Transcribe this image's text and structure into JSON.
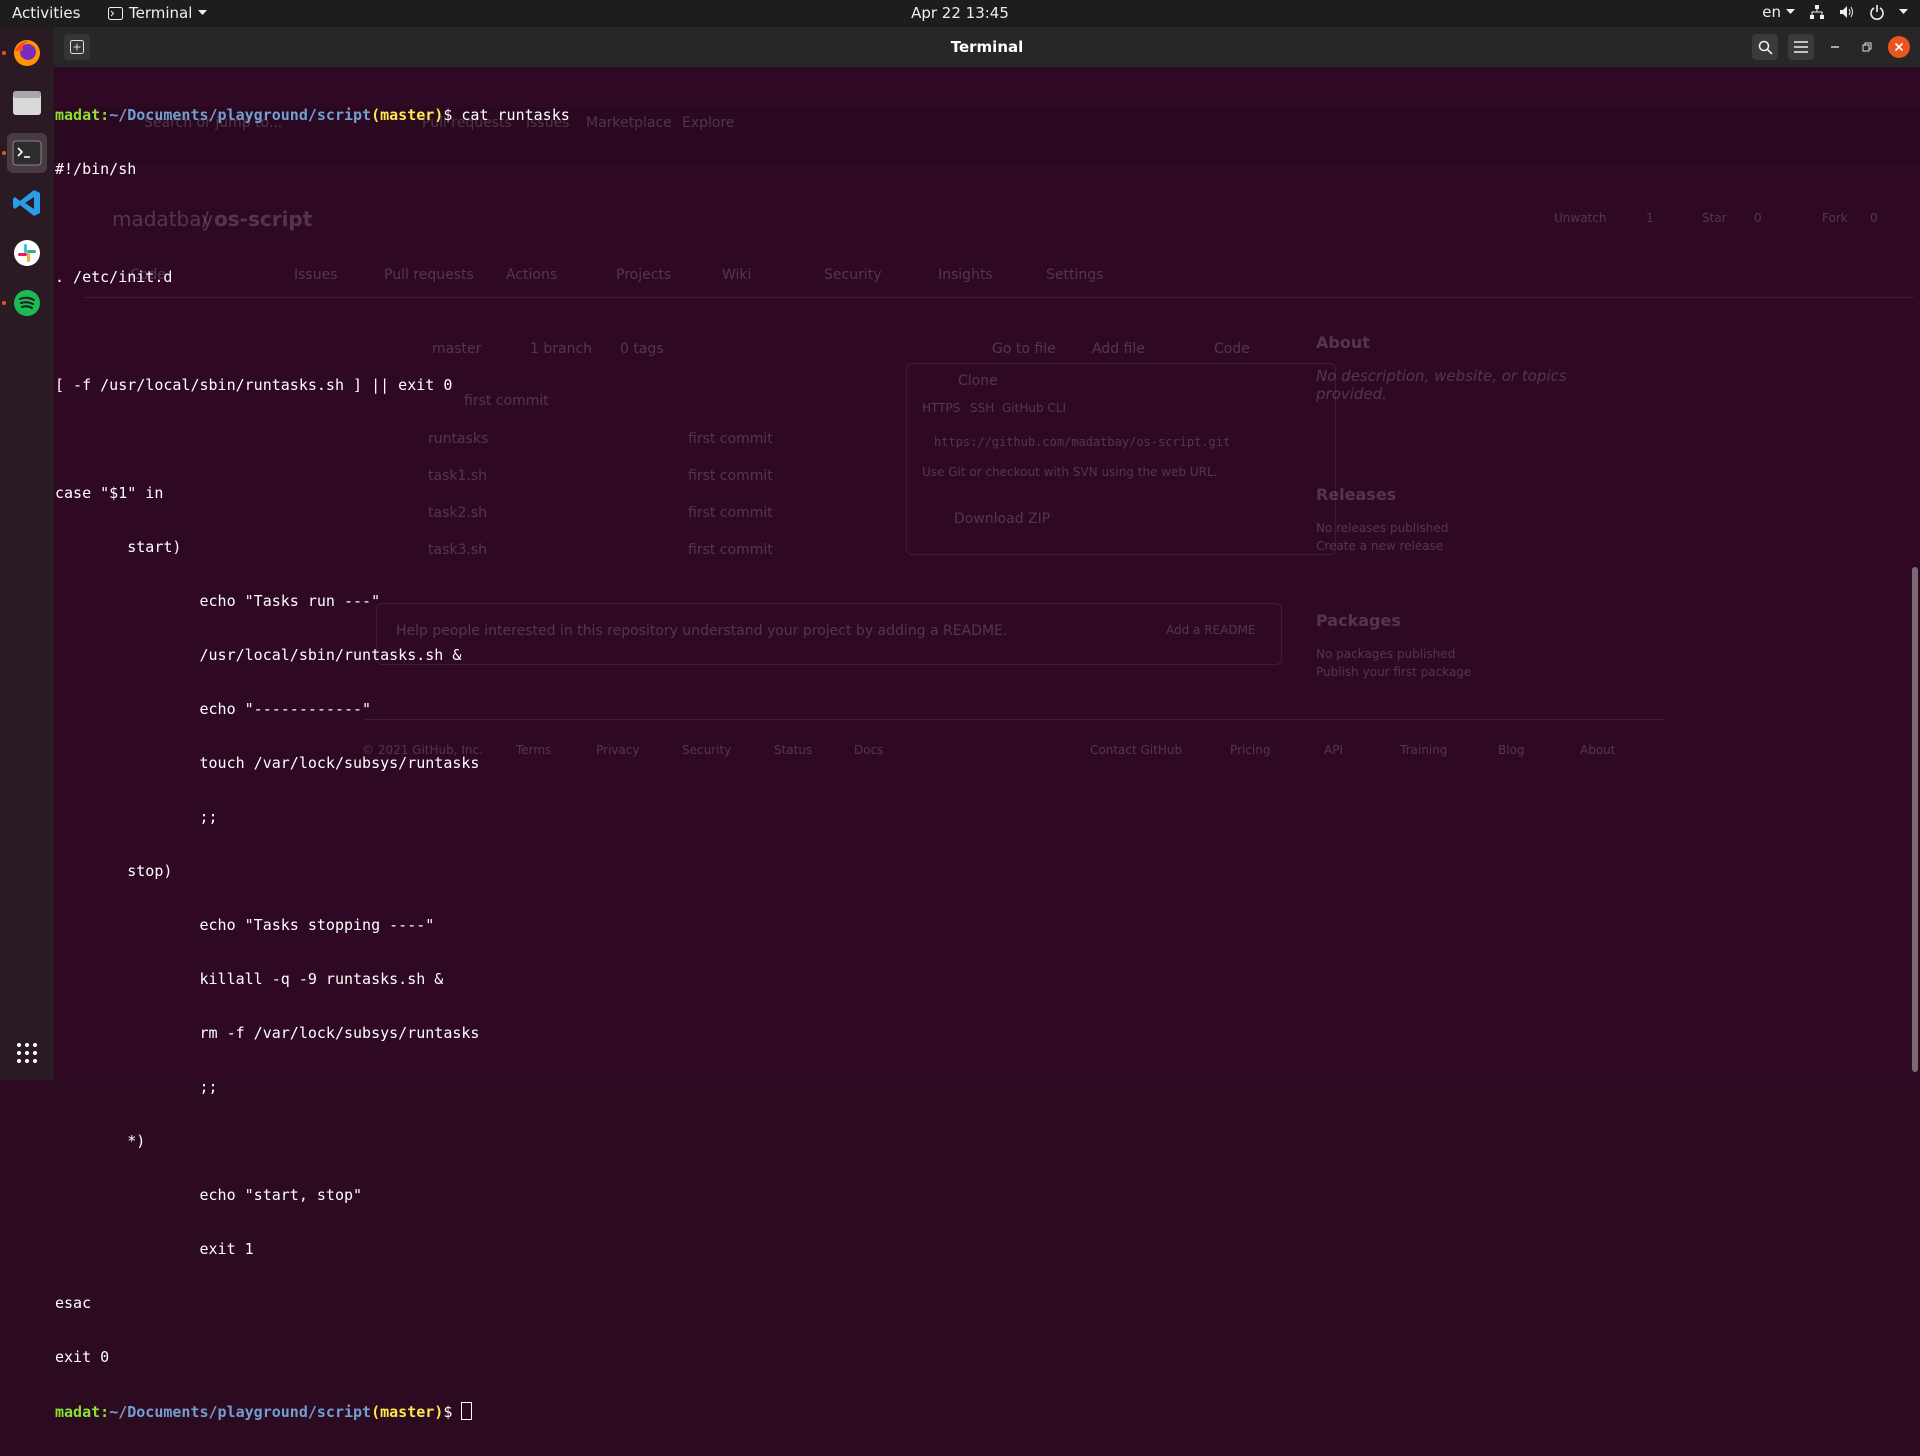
{
  "topbar": {
    "activities": "Activities",
    "app_name": "Terminal",
    "clock": "Apr 22  13:45",
    "lang": "en"
  },
  "dock": {
    "items": [
      "firefox-icon",
      "files-icon",
      "terminal-icon",
      "vscode-icon",
      "slack-icon",
      "spotify-icon"
    ],
    "apps_grid": "show-applications-icon"
  },
  "window": {
    "title": "Terminal"
  },
  "terminal": {
    "prompt_user": "madat",
    "prompt_path": "~/Documents/playground/script",
    "prompt_branch": "(master)",
    "command": "cat runtasks",
    "output": [
      "#!/bin/sh",
      "",
      ". /etc/init.d",
      "",
      "[ -f /usr/local/sbin/runtasks.sh ] || exit 0",
      "",
      "case \"$1\" in",
      "        start)",
      "                echo \"Tasks run ---\"",
      "                /usr/local/sbin/runtasks.sh &",
      "                echo \"------------\"",
      "                touch /var/lock/subsys/runtasks",
      "                ;;",
      "        stop)",
      "                echo \"Tasks stopping ----\"",
      "                killall -q -9 runtasks.sh &",
      "                rm -f /var/lock/subsys/runtasks",
      "                ;;",
      "        *)",
      "                echo \"start, stop\"",
      "                exit 1",
      "esac",
      "exit 0"
    ]
  },
  "ghost": {
    "nav": [
      "Pull requests",
      "Issues",
      "Marketplace",
      "Explore"
    ],
    "search_placeholder": "Search or jump to...",
    "repo_owner": "madatbay",
    "repo_sep": "/",
    "repo_name": "os-script",
    "tabs": [
      "Code",
      "Issues",
      "Pull requests",
      "Actions",
      "Projects",
      "Wiki",
      "Security",
      "Insights",
      "Settings"
    ],
    "unwatch": "Unwatch",
    "unwatch_count": "1",
    "star": "Star",
    "star_count": "0",
    "fork": "Fork",
    "fork_count": "0",
    "branch_btn": "master",
    "branches": "1 branch",
    "tags": "0 tags",
    "go_to_file": "Go to file",
    "add_file": "Add file",
    "code_btn": "Code",
    "commit_msg": "first commit",
    "files": [
      {
        "name": "runtasks",
        "commit": "first commit"
      },
      {
        "name": "task1.sh",
        "commit": "first commit"
      },
      {
        "name": "task2.sh",
        "commit": "first commit"
      },
      {
        "name": "task3.sh",
        "commit": "first commit"
      }
    ],
    "clone_title": "Clone",
    "clone_tabs": [
      "HTTPS",
      "SSH",
      "GitHub CLI"
    ],
    "clone_url": "https://github.com/madatbay/os-script.git",
    "clone_hint": "Use Git or checkout with SVN using the web URL.",
    "download_zip": "Download ZIP",
    "readme_text": "Help people interested in this repository understand your project by adding a README.",
    "add_readme": "Add a README",
    "about_title": "About",
    "about_text": "No description, website, or topics provided.",
    "releases_title": "Releases",
    "releases_text": "No releases published",
    "releases_link": "Create a new release",
    "packages_title": "Packages",
    "packages_text": "No packages published",
    "packages_link": "Publish your first package",
    "footer": [
      "© 2021 GitHub, Inc.",
      "Terms",
      "Privacy",
      "Security",
      "Status",
      "Docs",
      "Contact GitHub",
      "Pricing",
      "API",
      "Training",
      "Blog",
      "About"
    ]
  }
}
